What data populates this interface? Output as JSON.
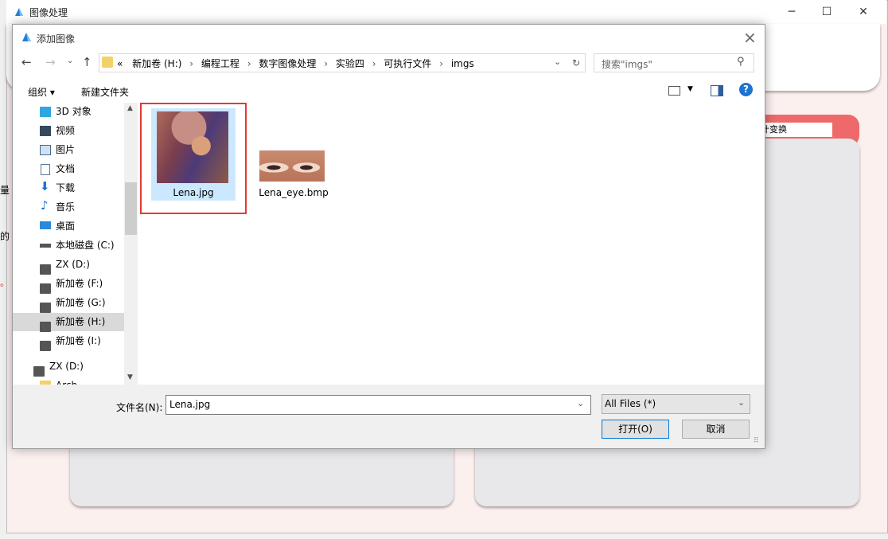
{
  "background_app": {
    "title": "图像处理",
    "partial_card_label": "叶变换",
    "left_edge_fragments": [
      "量",
      "的",
      "。"
    ]
  },
  "dialog": {
    "title": "添加图像",
    "close": "×",
    "breadcrumb": {
      "prefix": "«",
      "items": [
        "新加卷 (H:)",
        "编程工程",
        "数字图像处理",
        "实验四",
        "可执行文件",
        "imgs"
      ]
    },
    "search_placeholder": "搜索\"imgs\"",
    "toolbar": {
      "organize": "组织 ▾",
      "new_folder": "新建文件夹"
    },
    "nav_items": [
      {
        "label": "3D 对象",
        "icon": "3d-objects-icon"
      },
      {
        "label": "视频",
        "icon": "video-icon"
      },
      {
        "label": "图片",
        "icon": "pictures-icon"
      },
      {
        "label": "文档",
        "icon": "documents-icon"
      },
      {
        "label": "下载",
        "icon": "download-icon"
      },
      {
        "label": "音乐",
        "icon": "music-icon"
      },
      {
        "label": "桌面",
        "icon": "desktop-icon"
      },
      {
        "label": "本地磁盘 (C:)",
        "icon": "os-drive-icon"
      },
      {
        "label": "ZX (D:)",
        "icon": "drive-icon"
      },
      {
        "label": "新加卷 (F:)",
        "icon": "drive-icon"
      },
      {
        "label": "新加卷 (G:)",
        "icon": "drive-icon"
      },
      {
        "label": "新加卷 (H:)",
        "icon": "drive-icon",
        "selected": true
      },
      {
        "label": "新加卷 (I:)",
        "icon": "drive-icon"
      }
    ],
    "nav_secondary": {
      "label": "ZX (D:)"
    },
    "nav_cutoff": "Arch...",
    "files": [
      {
        "name": "Lena.jpg",
        "selected": true
      },
      {
        "name": "Lena_eye.bmp",
        "selected": false
      }
    ],
    "filename_label": "文件名(N):",
    "filename_value": "Lena.jpg",
    "filter_value": "All Files  (*)",
    "open_button": "打开(O)",
    "cancel_button": "取消"
  },
  "colors": {
    "highlight_box": "#e53935",
    "card_accent": "#ee6a6a",
    "help": "#1e73d2"
  }
}
